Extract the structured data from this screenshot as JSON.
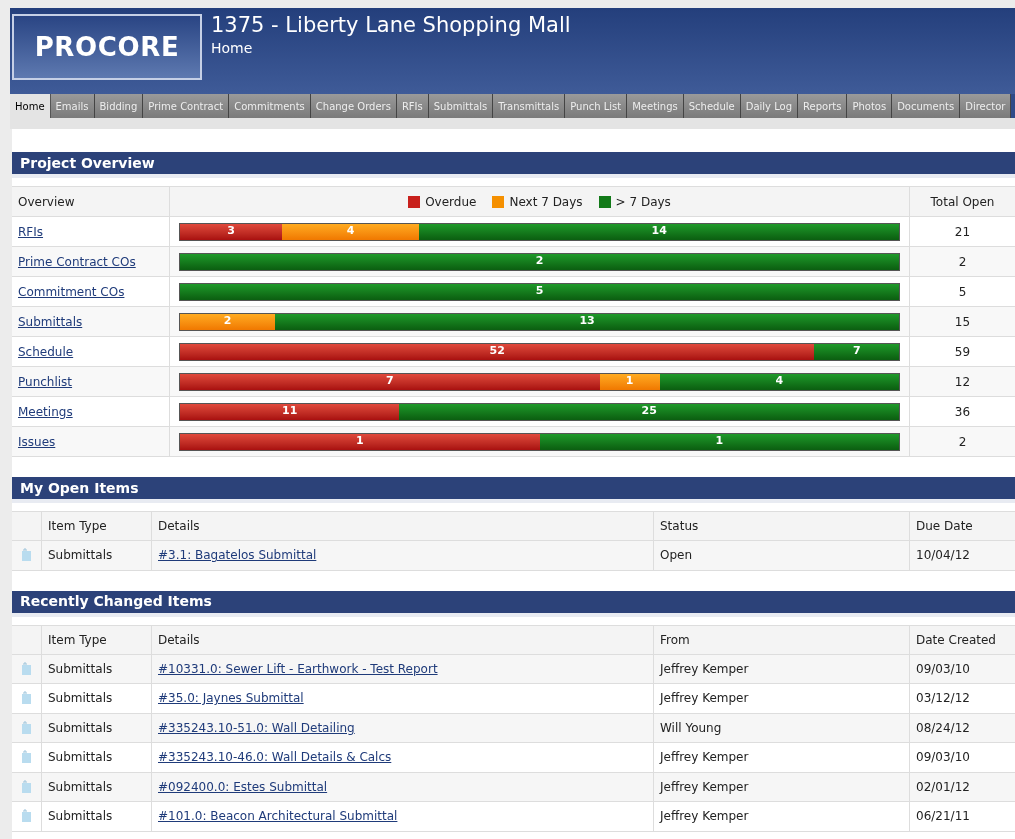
{
  "header": {
    "logo": "PROCORE",
    "project_title": "1375 - Liberty Lane Shopping Mall",
    "page": "Home"
  },
  "tabs": [
    {
      "label": "Home",
      "selected": true
    },
    {
      "label": "Emails",
      "selected": false
    },
    {
      "label": "Bidding",
      "selected": false
    },
    {
      "label": "Prime Contract",
      "selected": false
    },
    {
      "label": "Commitments",
      "selected": false
    },
    {
      "label": "Change Orders",
      "selected": false
    },
    {
      "label": "RFIs",
      "selected": false
    },
    {
      "label": "Submittals",
      "selected": false
    },
    {
      "label": "Transmittals",
      "selected": false
    },
    {
      "label": "Punch List",
      "selected": false
    },
    {
      "label": "Meetings",
      "selected": false
    },
    {
      "label": "Schedule",
      "selected": false
    },
    {
      "label": "Daily Log",
      "selected": false
    },
    {
      "label": "Reports",
      "selected": false
    },
    {
      "label": "Photos",
      "selected": false
    },
    {
      "label": "Documents",
      "selected": false
    },
    {
      "label": "Director",
      "selected": false
    }
  ],
  "project_overview": {
    "title": "Project Overview",
    "columns": [
      "Overview",
      "Total Open"
    ],
    "legend": [
      {
        "kind": "overdue",
        "label": "Overdue"
      },
      {
        "kind": "next7",
        "label": "Next 7 Days"
      },
      {
        "kind": "later",
        "label": "> 7 Days"
      }
    ],
    "rows": [
      {
        "name": "RFIs",
        "segments": [
          {
            "kind": "overdue",
            "value": "3"
          },
          {
            "kind": "next7",
            "value": "4"
          },
          {
            "kind": "later",
            "value": "14"
          }
        ],
        "total": "21"
      },
      {
        "name": "Prime Contract COs",
        "segments": [
          {
            "kind": "later",
            "value": "2"
          }
        ],
        "total": "2"
      },
      {
        "name": "Commitment COs",
        "segments": [
          {
            "kind": "later",
            "value": "5"
          }
        ],
        "total": "5"
      },
      {
        "name": "Submittals",
        "segments": [
          {
            "kind": "next7",
            "value": "2"
          },
          {
            "kind": "later",
            "value": "13"
          }
        ],
        "total": "15"
      },
      {
        "name": "Schedule",
        "segments": [
          {
            "kind": "overdue",
            "value": "52"
          },
          {
            "kind": "later",
            "value": "7"
          }
        ],
        "total": "59"
      },
      {
        "name": "Punchlist",
        "segments": [
          {
            "kind": "overdue",
            "value": "7"
          },
          {
            "kind": "next7",
            "value": "1"
          },
          {
            "kind": "later",
            "value": "4"
          }
        ],
        "total": "12"
      },
      {
        "name": "Meetings",
        "segments": [
          {
            "kind": "overdue",
            "value": "11"
          },
          {
            "kind": "later",
            "value": "25"
          }
        ],
        "total": "36"
      },
      {
        "name": "Issues",
        "segments": [
          {
            "kind": "overdue",
            "value": "1"
          },
          {
            "kind": "later",
            "value": "1"
          }
        ],
        "total": "2"
      }
    ]
  },
  "my_open_items": {
    "title": "My Open Items",
    "columns": [
      "Item Type",
      "Details",
      "Status",
      "Due Date"
    ],
    "rows": [
      {
        "item_type": "Submittals",
        "details": "#3.1: Bagatelos Submittal",
        "status": "Open",
        "date": "10/04/12"
      }
    ]
  },
  "recently_changed_items": {
    "title": "Recently Changed Items",
    "columns": [
      "Item Type",
      "Details",
      "From",
      "Date Created"
    ],
    "rows": [
      {
        "item_type": "Submittals",
        "details": "#10331.0: Sewer Lift - Earthwork - Test Report",
        "from": "Jeffrey Kemper",
        "date": "09/03/10"
      },
      {
        "item_type": "Submittals",
        "details": "#35.0: Jaynes Submittal",
        "from": "Jeffrey Kemper",
        "date": "03/12/12"
      },
      {
        "item_type": "Submittals",
        "details": "#335243.10-51.0: Wall Detailing",
        "from": "Will Young",
        "date": "08/24/12"
      },
      {
        "item_type": "Submittals",
        "details": "#335243.10-46.0: Wall Details & Calcs",
        "from": "Jeffrey Kemper",
        "date": "09/03/10"
      },
      {
        "item_type": "Submittals",
        "details": "#092400.0: Estes Submittal",
        "from": "Jeffrey Kemper",
        "date": "02/01/12"
      },
      {
        "item_type": "Submittals",
        "details": "#101.0: Beacon Architectural Submittal",
        "from": "Jeffrey Kemper",
        "date": "06/21/11"
      }
    ]
  }
}
